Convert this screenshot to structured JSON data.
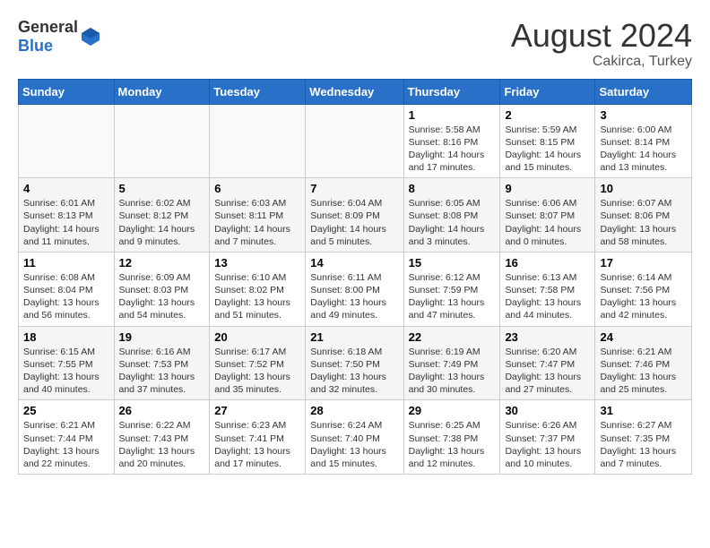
{
  "header": {
    "logo_general": "General",
    "logo_blue": "Blue",
    "month": "August 2024",
    "location": "Cakirca, Turkey"
  },
  "days_of_week": [
    "Sunday",
    "Monday",
    "Tuesday",
    "Wednesday",
    "Thursday",
    "Friday",
    "Saturday"
  ],
  "weeks": [
    [
      {
        "day": "",
        "text": ""
      },
      {
        "day": "",
        "text": ""
      },
      {
        "day": "",
        "text": ""
      },
      {
        "day": "",
        "text": ""
      },
      {
        "day": "1",
        "text": "Sunrise: 5:58 AM\nSunset: 8:16 PM\nDaylight: 14 hours and 17 minutes."
      },
      {
        "day": "2",
        "text": "Sunrise: 5:59 AM\nSunset: 8:15 PM\nDaylight: 14 hours and 15 minutes."
      },
      {
        "day": "3",
        "text": "Sunrise: 6:00 AM\nSunset: 8:14 PM\nDaylight: 14 hours and 13 minutes."
      }
    ],
    [
      {
        "day": "4",
        "text": "Sunrise: 6:01 AM\nSunset: 8:13 PM\nDaylight: 14 hours and 11 minutes."
      },
      {
        "day": "5",
        "text": "Sunrise: 6:02 AM\nSunset: 8:12 PM\nDaylight: 14 hours and 9 minutes."
      },
      {
        "day": "6",
        "text": "Sunrise: 6:03 AM\nSunset: 8:11 PM\nDaylight: 14 hours and 7 minutes."
      },
      {
        "day": "7",
        "text": "Sunrise: 6:04 AM\nSunset: 8:09 PM\nDaylight: 14 hours and 5 minutes."
      },
      {
        "day": "8",
        "text": "Sunrise: 6:05 AM\nSunset: 8:08 PM\nDaylight: 14 hours and 3 minutes."
      },
      {
        "day": "9",
        "text": "Sunrise: 6:06 AM\nSunset: 8:07 PM\nDaylight: 14 hours and 0 minutes."
      },
      {
        "day": "10",
        "text": "Sunrise: 6:07 AM\nSunset: 8:06 PM\nDaylight: 13 hours and 58 minutes."
      }
    ],
    [
      {
        "day": "11",
        "text": "Sunrise: 6:08 AM\nSunset: 8:04 PM\nDaylight: 13 hours and 56 minutes."
      },
      {
        "day": "12",
        "text": "Sunrise: 6:09 AM\nSunset: 8:03 PM\nDaylight: 13 hours and 54 minutes."
      },
      {
        "day": "13",
        "text": "Sunrise: 6:10 AM\nSunset: 8:02 PM\nDaylight: 13 hours and 51 minutes."
      },
      {
        "day": "14",
        "text": "Sunrise: 6:11 AM\nSunset: 8:00 PM\nDaylight: 13 hours and 49 minutes."
      },
      {
        "day": "15",
        "text": "Sunrise: 6:12 AM\nSunset: 7:59 PM\nDaylight: 13 hours and 47 minutes."
      },
      {
        "day": "16",
        "text": "Sunrise: 6:13 AM\nSunset: 7:58 PM\nDaylight: 13 hours and 44 minutes."
      },
      {
        "day": "17",
        "text": "Sunrise: 6:14 AM\nSunset: 7:56 PM\nDaylight: 13 hours and 42 minutes."
      }
    ],
    [
      {
        "day": "18",
        "text": "Sunrise: 6:15 AM\nSunset: 7:55 PM\nDaylight: 13 hours and 40 minutes."
      },
      {
        "day": "19",
        "text": "Sunrise: 6:16 AM\nSunset: 7:53 PM\nDaylight: 13 hours and 37 minutes."
      },
      {
        "day": "20",
        "text": "Sunrise: 6:17 AM\nSunset: 7:52 PM\nDaylight: 13 hours and 35 minutes."
      },
      {
        "day": "21",
        "text": "Sunrise: 6:18 AM\nSunset: 7:50 PM\nDaylight: 13 hours and 32 minutes."
      },
      {
        "day": "22",
        "text": "Sunrise: 6:19 AM\nSunset: 7:49 PM\nDaylight: 13 hours and 30 minutes."
      },
      {
        "day": "23",
        "text": "Sunrise: 6:20 AM\nSunset: 7:47 PM\nDaylight: 13 hours and 27 minutes."
      },
      {
        "day": "24",
        "text": "Sunrise: 6:21 AM\nSunset: 7:46 PM\nDaylight: 13 hours and 25 minutes."
      }
    ],
    [
      {
        "day": "25",
        "text": "Sunrise: 6:21 AM\nSunset: 7:44 PM\nDaylight: 13 hours and 22 minutes."
      },
      {
        "day": "26",
        "text": "Sunrise: 6:22 AM\nSunset: 7:43 PM\nDaylight: 13 hours and 20 minutes."
      },
      {
        "day": "27",
        "text": "Sunrise: 6:23 AM\nSunset: 7:41 PM\nDaylight: 13 hours and 17 minutes."
      },
      {
        "day": "28",
        "text": "Sunrise: 6:24 AM\nSunset: 7:40 PM\nDaylight: 13 hours and 15 minutes."
      },
      {
        "day": "29",
        "text": "Sunrise: 6:25 AM\nSunset: 7:38 PM\nDaylight: 13 hours and 12 minutes."
      },
      {
        "day": "30",
        "text": "Sunrise: 6:26 AM\nSunset: 7:37 PM\nDaylight: 13 hours and 10 minutes."
      },
      {
        "day": "31",
        "text": "Sunrise: 6:27 AM\nSunset: 7:35 PM\nDaylight: 13 hours and 7 minutes."
      }
    ]
  ]
}
